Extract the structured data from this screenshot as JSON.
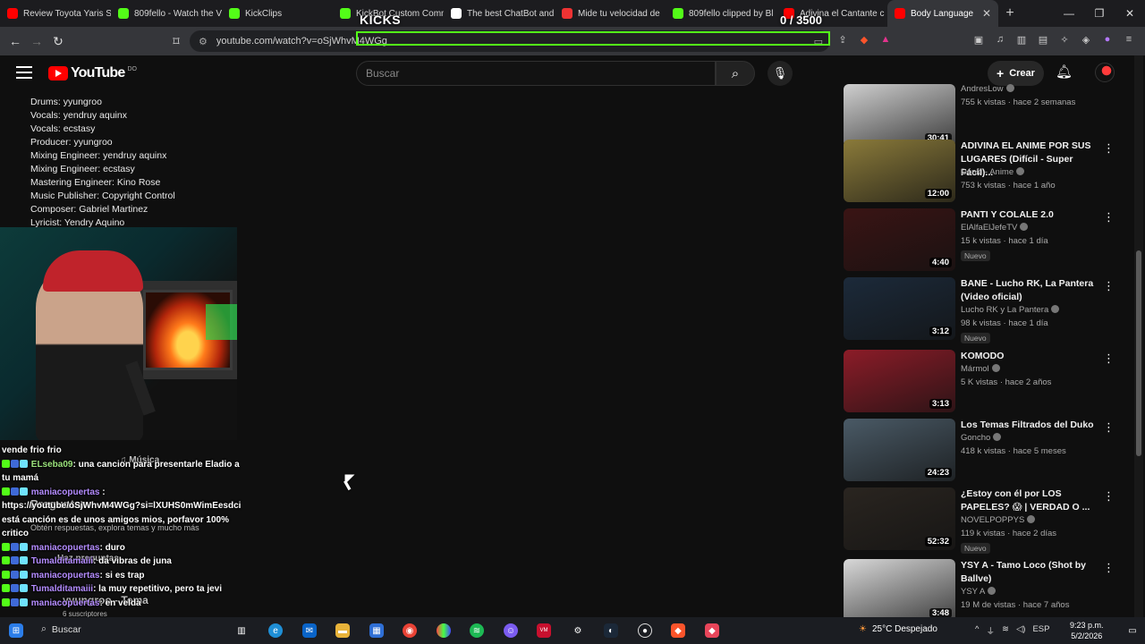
{
  "browser": {
    "tabs": [
      {
        "title": "Review Toyota Yaris Sedan",
        "icon_color": "#ff0000"
      },
      {
        "title": "809fello - Watch the V",
        "icon_color": "#53fc18"
      },
      {
        "title": "KickClips",
        "icon_color": "#53fc18"
      },
      {
        "title": "KickBot Custom Comm",
        "icon_color": "#53fc18"
      },
      {
        "title": "The best ChatBot and",
        "icon_color": "#ffffff"
      },
      {
        "title": "Mide tu velocidad de",
        "icon_color": "#e33"
      },
      {
        "title": "809fello clipped by Bl",
        "icon_color": "#53fc18"
      },
      {
        "title": "Adivina el Cantante c",
        "icon_color": "#ff0000"
      },
      {
        "title": "Body Language",
        "icon_color": "#ff0000",
        "active": true
      }
    ],
    "url": "youtube.com/watch?v=oSjWhvM4WGg"
  },
  "overlay": {
    "kicks_label": "KICKS",
    "kicks_count": "0 / 3500"
  },
  "youtube": {
    "logo_text": "YouTube",
    "logo_region": "DO",
    "search_placeholder": "Buscar",
    "create_label": "Crear"
  },
  "description": [
    "Drums: yyungroo",
    "Vocals: yendruy aquinx",
    "Vocals: ecstasy",
    "Producer: yyungroo",
    "Mixing Engineer: yendruy aquinx",
    "Mixing Engineer: ecstasy",
    "Mastering Engineer: Kino Rose",
    "Music Publisher: Copyright Control",
    "Composer: Gabriel Martinez",
    "Lyricist: Yendry Aquino"
  ],
  "chat": {
    "first_line": "vende frio frio",
    "messages": [
      {
        "user": "ELseba09",
        "text": ": una cancion para presentarle Eladio a",
        "cont": "tu mamá"
      },
      {
        "user": "maniacopuertas",
        "text": " :",
        "cont": "https://youtube/oSjWhvM4WGg?si=lXUHS0mWimEesdci",
        "cont2": "está canción es de unos amigos mios, porfavor 100%",
        "cont3": "critico"
      },
      {
        "user": "maniacopuertas",
        "text": ": duro"
      },
      {
        "user": "Tumalditamaiii",
        "text": ": da vibras de juna"
      },
      {
        "user": "maniacopuertas",
        "text": ": si es trap"
      },
      {
        "user": "Tumalditamaiii",
        "text": ": la muy repetitivo, pero ta jevi"
      },
      {
        "user": "maniacopuertas",
        "text": ": en velda"
      }
    ],
    "ghost_music": "Música",
    "ghost_preguntar": "Preguntar",
    "ghost_sub": "Obtén respuestas, explora temas y mucho más",
    "ghost_haz": "Haz preguntas",
    "ghost_channel": "yyungroo - Tema",
    "ghost_subs": "6 suscriptores"
  },
  "recommendations": [
    {
      "title": "",
      "channel": "AndresLow",
      "meta": "755 k vistas · hace 2 semanas",
      "duration": "30:41",
      "new": "",
      "thumb": "#cfcfcf"
    },
    {
      "title": "ADIVINA EL ANIME POR SUS LUGARES (Difícil - Super Fácil)...",
      "channel": "Donki - Anime",
      "meta": "753 k vistas · hace 1 año",
      "duration": "12:00",
      "new": "",
      "thumb": "#8a7a3a"
    },
    {
      "title": "PANTI Y COLALE 2.0",
      "channel": "ElAlfaElJefeTV",
      "meta": "15 k vistas · hace 1 día",
      "duration": "4:40",
      "new": "Nuevo",
      "thumb": "#3a1414"
    },
    {
      "title": "BANE - Lucho RK, La Pantera (Video oficial)",
      "channel": "Lucho RK y La Pantera",
      "meta": "98 k vistas · hace 1 día",
      "duration": "3:12",
      "new": "Nuevo",
      "thumb": "#1c2a3a"
    },
    {
      "title": "KOMODO",
      "channel": "Mármol",
      "meta": "5 K vistas · hace 2 años",
      "duration": "3:13",
      "new": "",
      "thumb": "#8c1c28"
    },
    {
      "title": "Los Temas Filtrados del Duko",
      "channel": "Goncho",
      "meta": "418 k vistas · hace 5 meses",
      "duration": "24:23",
      "new": "",
      "thumb": "#4a5a66"
    },
    {
      "title": "¿Estoy con él por LOS PAPELES? 😱 | VERDAD O ...",
      "channel": "NOVELPOPPYS",
      "meta": "119 k vistas · hace 2 días",
      "duration": "52:32",
      "new": "Nuevo",
      "thumb": "#2a2520"
    },
    {
      "title": "YSY A - Tamo Loco (Shot by Ballve)",
      "channel": "YSY A",
      "meta": "19 M de vistas · hace 7 años",
      "duration": "3:48",
      "new": "",
      "thumb": "#d8d8d8"
    }
  ],
  "taskbar": {
    "search_label": "Buscar",
    "weather": "25°C  Despejado",
    "lang": "ESP",
    "time": "9:23 p.m.",
    "date": "5/2/2026"
  }
}
